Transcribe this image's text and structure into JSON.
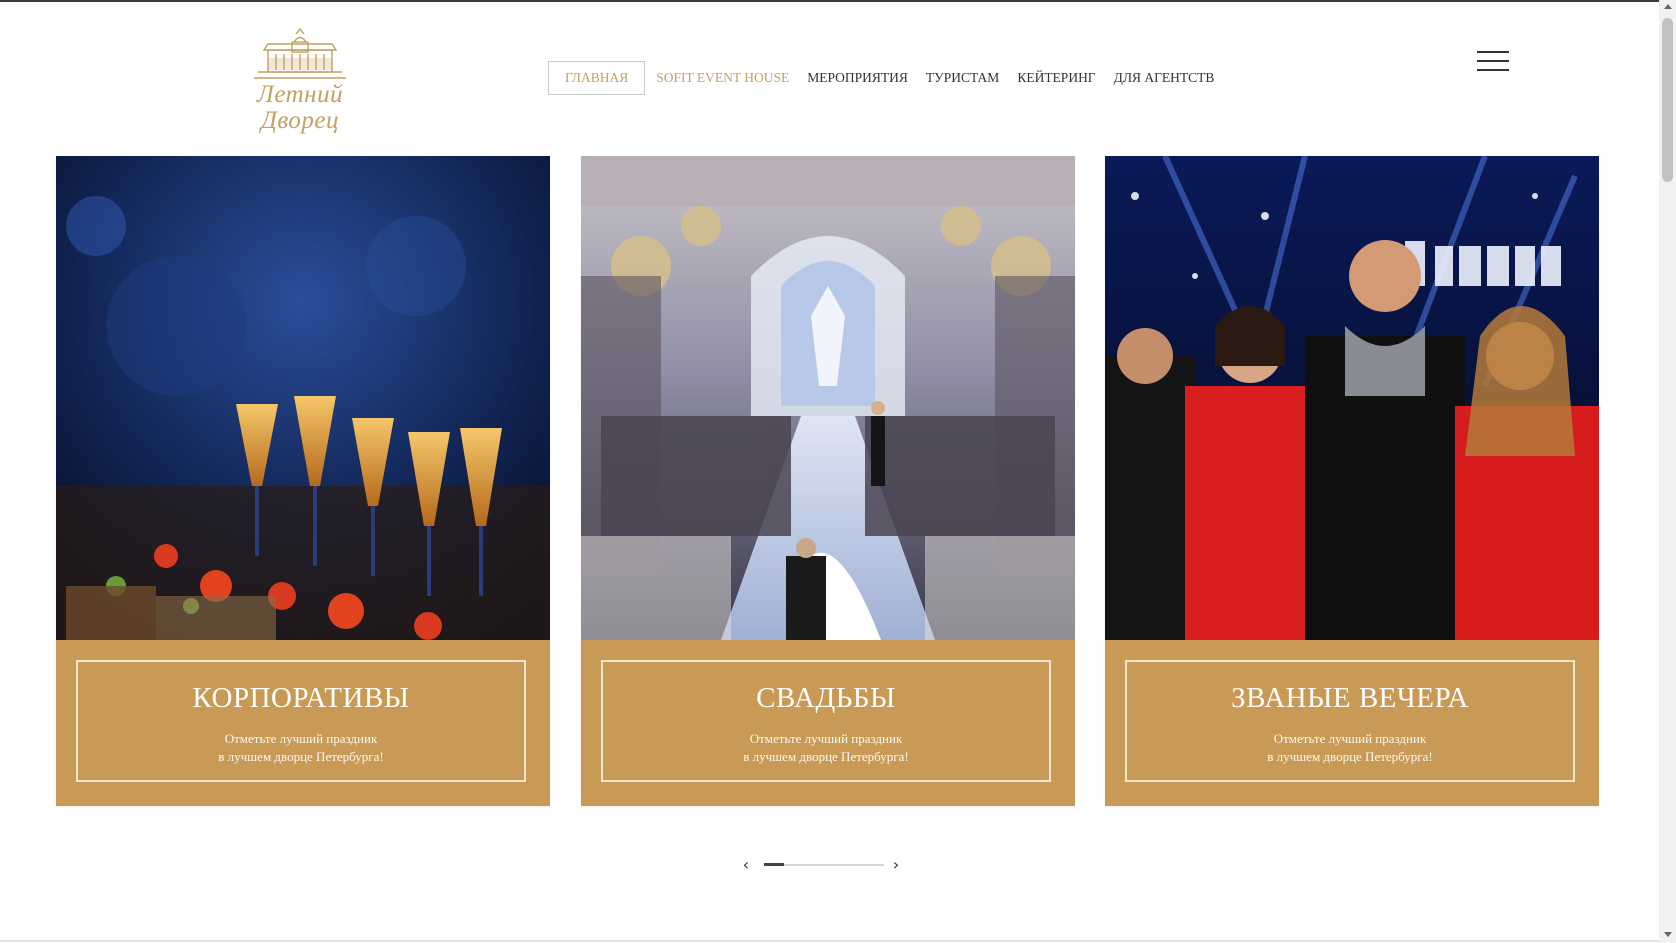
{
  "header": {
    "logo": {
      "title": "Летний Дворец",
      "subtitle": ""
    },
    "nav": [
      {
        "label": "ГЛАВНАЯ",
        "active": true
      },
      {
        "label": "SOFIT EVENT HOUSE",
        "active": false
      },
      {
        "label": "МЕРОПРИЯТИЯ",
        "active": false
      },
      {
        "label": "ТУРИСТАМ",
        "active": false
      },
      {
        "label": "КЕЙТЕРИНГ",
        "active": false
      },
      {
        "label": "ДЛЯ АГЕНТСТВ",
        "active": false
      }
    ],
    "menu_icon": "hamburger-icon"
  },
  "cards": [
    {
      "title": "КОРПОРАТИВЫ",
      "text_line1": "Отметьте лучший праздник",
      "text_line2": "в лучшем дворце Петербурга!",
      "image": "catering-glasses-photo"
    },
    {
      "title": "СВАДЬБЫ",
      "text_line1": "Отметьте лучший праздник",
      "text_line2": "в лучшем дворце Петербурга!",
      "image": "wedding-hall-photo"
    },
    {
      "title": "ЗВАНЫЕ ВЕЧЕРА",
      "text_line1": "Отметьте лучший праздник",
      "text_line2": "в лучшем дворце Петербурга!",
      "image": "party-guests-photo"
    }
  ],
  "carousel": {
    "prev_icon": "chevron-left-icon",
    "next_icon": "chevron-right-icon",
    "prev_glyph": "‹",
    "next_glyph": "›"
  },
  "colors": {
    "gold": "#c89a55",
    "gold_text": "#c4a062",
    "text": "#333333"
  }
}
